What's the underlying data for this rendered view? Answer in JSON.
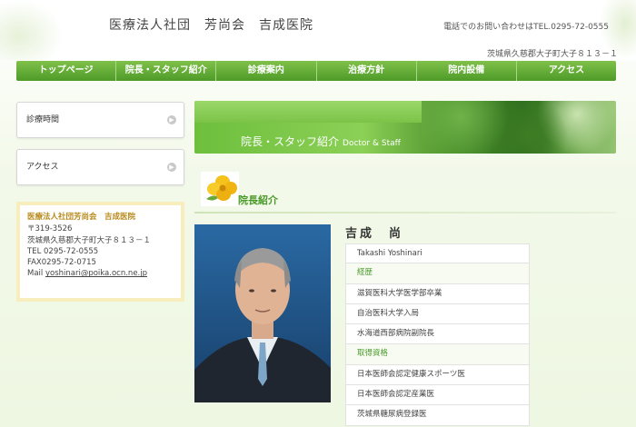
{
  "header": {
    "site_title": "医療法人社団　芳尚会　吉成医院",
    "phone": "電話でのお問い合わせはTEL.0295-72-0555",
    "address": "茨城県久慈郡大子町大子８１３－１"
  },
  "nav": {
    "items": [
      "トップページ",
      "院長・スタッフ紹介",
      "診療案内",
      "治療方針",
      "院内設備",
      "アクセス"
    ]
  },
  "sidebar": {
    "buttons": [
      "診療時間",
      "アクセス"
    ],
    "contact": {
      "org": "医療法人社団芳尚会　吉成医院",
      "postal": "〒319-3526",
      "address": "茨城県久慈郡大子町大子８１３－１",
      "tel": "TEL 0295-72-0555",
      "fax": "FAX0295-72-0715",
      "mail_label": "Mail ",
      "mail": "yoshinari@poika.ocn.ne.jp"
    }
  },
  "banner": {
    "title": "院長・スタッフ紹介",
    "subtitle": "Doctor & Staff"
  },
  "section": {
    "title": "院長紹介"
  },
  "doctor": {
    "name": "吉成　尚",
    "rows": [
      {
        "text": "Takashi Yoshinari",
        "type": "plain"
      },
      {
        "text": "経歴",
        "type": "head"
      },
      {
        "text": "滋賀医科大学医学部卒業",
        "type": "plain"
      },
      {
        "text": "自治医科大学入局",
        "type": "plain"
      },
      {
        "text": "水海道西部病院副院長",
        "type": "plain"
      },
      {
        "text": "取得資格",
        "type": "head"
      },
      {
        "text": "日本医師会認定健康スポーツ医",
        "type": "flush"
      },
      {
        "text": "日本医師会認定産業医",
        "type": "plain"
      },
      {
        "text": "茨城県糖尿病登録医",
        "type": "plain"
      }
    ]
  },
  "colors": {
    "nav_green": "#4e9a28",
    "heading_green": "#4a9a2a",
    "contact_org": "#b88a1c"
  }
}
